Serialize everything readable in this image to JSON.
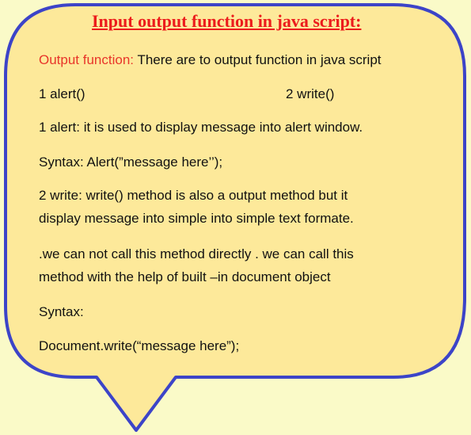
{
  "colors": {
    "background": "#fafac8",
    "bubble_fill": "#fde99a",
    "bubble_border": "#3c44c8",
    "title": "#ec1c1c",
    "highlight": "#e8352a"
  },
  "title": "Input output function in java script:",
  "output_label": "Output function:",
  "output_text": " There are to output function in java script",
  "functions": {
    "first": "1 alert()",
    "second": "2 write()"
  },
  "alert_desc": "1 alert: it is used to display message into alert window.",
  "alert_syntax": "Syntax: Alert(”message here’’);",
  "write_desc": {
    "line1": "2 write:  write() method is also a output method but it",
    "line2": "display message into simple into simple text formate."
  },
  "note": {
    "line1": " .we can not call this method  directly . we can call this",
    "line2": "method with the help of built –in document object"
  },
  "syntax_label": "Syntax:",
  "syntax_code": "Document.write(“message here”);"
}
